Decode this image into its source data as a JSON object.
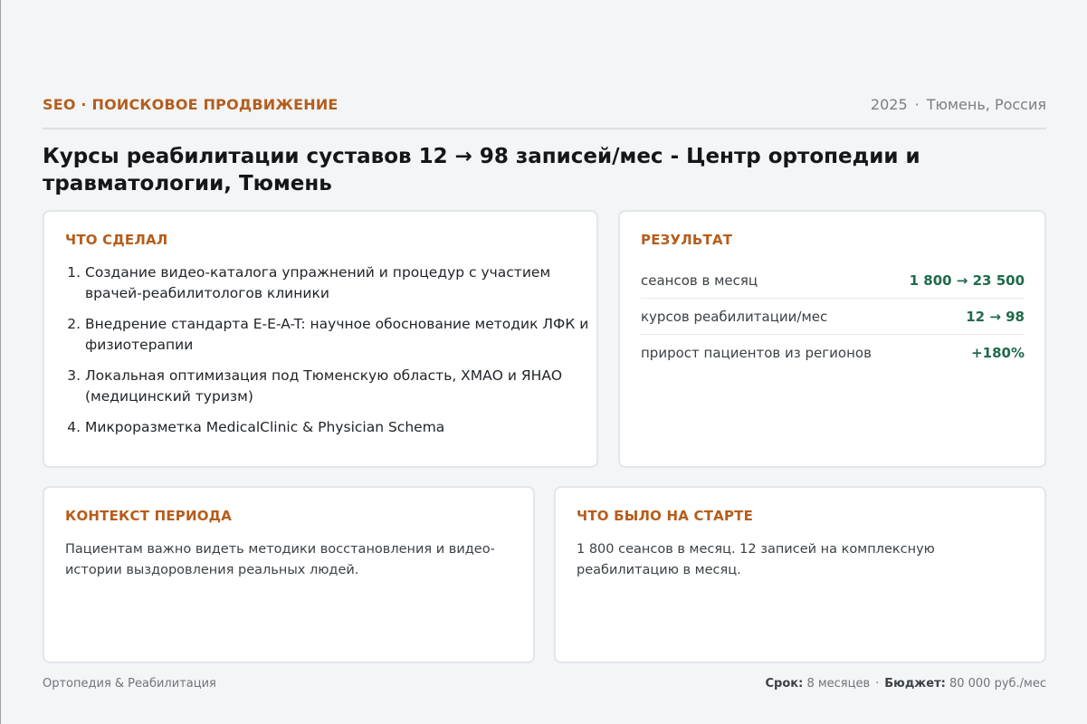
{
  "header": {
    "category": "SEO · ПОИСКОВОЕ ПРОДВИЖЕНИЕ",
    "year": "2025",
    "location": "Тюмень, Россия"
  },
  "title": "Курсы реабилитации суставов 12 → 98 записей/мес - Центр ортопедии и травматологии, Тюмень",
  "done": {
    "title": "ЧТО СДЕЛАЛ",
    "items": [
      "Создание видео-каталога упражнений и процедур с участием врачей-реабилитологов клиники",
      "Внедрение стандарта E-E-A-T: научное обоснование методик ЛФК и физиотерапии",
      "Локальная оптимизация под Тюменскую область, ХМАО и ЯНАО (медицинский туризм)",
      "Микроразметка MedicalClinic & Physician Schema"
    ]
  },
  "result": {
    "title": "РЕЗУЛЬТАТ",
    "metrics": [
      {
        "label": "сеансов в месяц",
        "value": "1 800 → 23 500"
      },
      {
        "label": "курсов реабилитации/мес",
        "value": "12 → 98"
      },
      {
        "label": "прирост пациентов из регионов",
        "value": "+180%"
      }
    ]
  },
  "context": {
    "title": "КОНТЕКСТ ПЕРИОДА",
    "text": "Пациентам важно видеть методики восстановления и видео-истории выздоровления реальных людей."
  },
  "start": {
    "title": "ЧТО БЫЛО НА СТАРТЕ",
    "text": "1 800 сеансов в месяц. 12 записей на комплексную реабилитацию в месяц."
  },
  "footer": {
    "industry": "Ортопедия & Реабилитация",
    "term_label": "Срок:",
    "term_value": "8 месяцев",
    "budget_label": "Бюджет:",
    "budget_value": "80 000 руб./мес"
  },
  "colors": {
    "accent": "#b55d1c",
    "positive": "#1e6b4a",
    "background": "#f3f5f7"
  }
}
